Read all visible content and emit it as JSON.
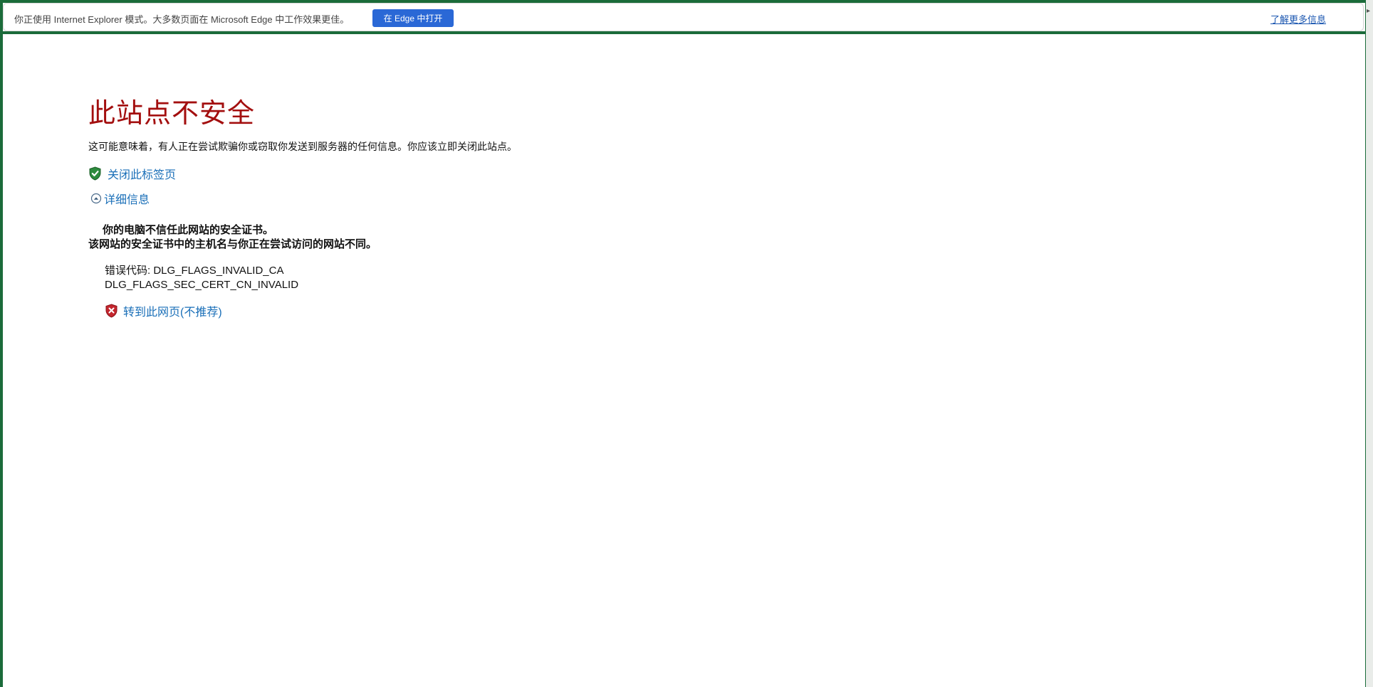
{
  "infobar": {
    "message": "你正使用 Internet Explorer 模式。大多数页面在 Microsoft Edge 中工作效果更佳。",
    "open_in_edge_label": "在 Edge 中打开",
    "learn_more_label": "了解更多信息"
  },
  "error_page": {
    "title": "此站点不安全",
    "description": "这可能意味着，有人正在尝试欺骗你或窃取你发送到服务器的任何信息。你应该立即关闭此站点。",
    "close_tab_label": "关闭此标签页",
    "details_label": "详细信息",
    "details": [
      "你的电脑不信任此网站的安全证书。",
      "该网站的安全证书中的主机名与你正在尝试访问的网站不同。"
    ],
    "error_code_label": "错误代码: DLG_FLAGS_INVALID_CA",
    "error_code_secondary": "DLG_FLAGS_SEC_CERT_CN_INVALID",
    "continue_label": "转到此网页(不推荐)"
  },
  "icons": {
    "close_tab": "green-shield-check-icon",
    "details_toggle": "collapse-circle-icon",
    "continue": "red-shield-x-icon"
  },
  "colors": {
    "frame": "#1b6b3a",
    "title": "#a30f0f",
    "link": "#1a6fb8",
    "edge_button": "#2a68d6"
  }
}
